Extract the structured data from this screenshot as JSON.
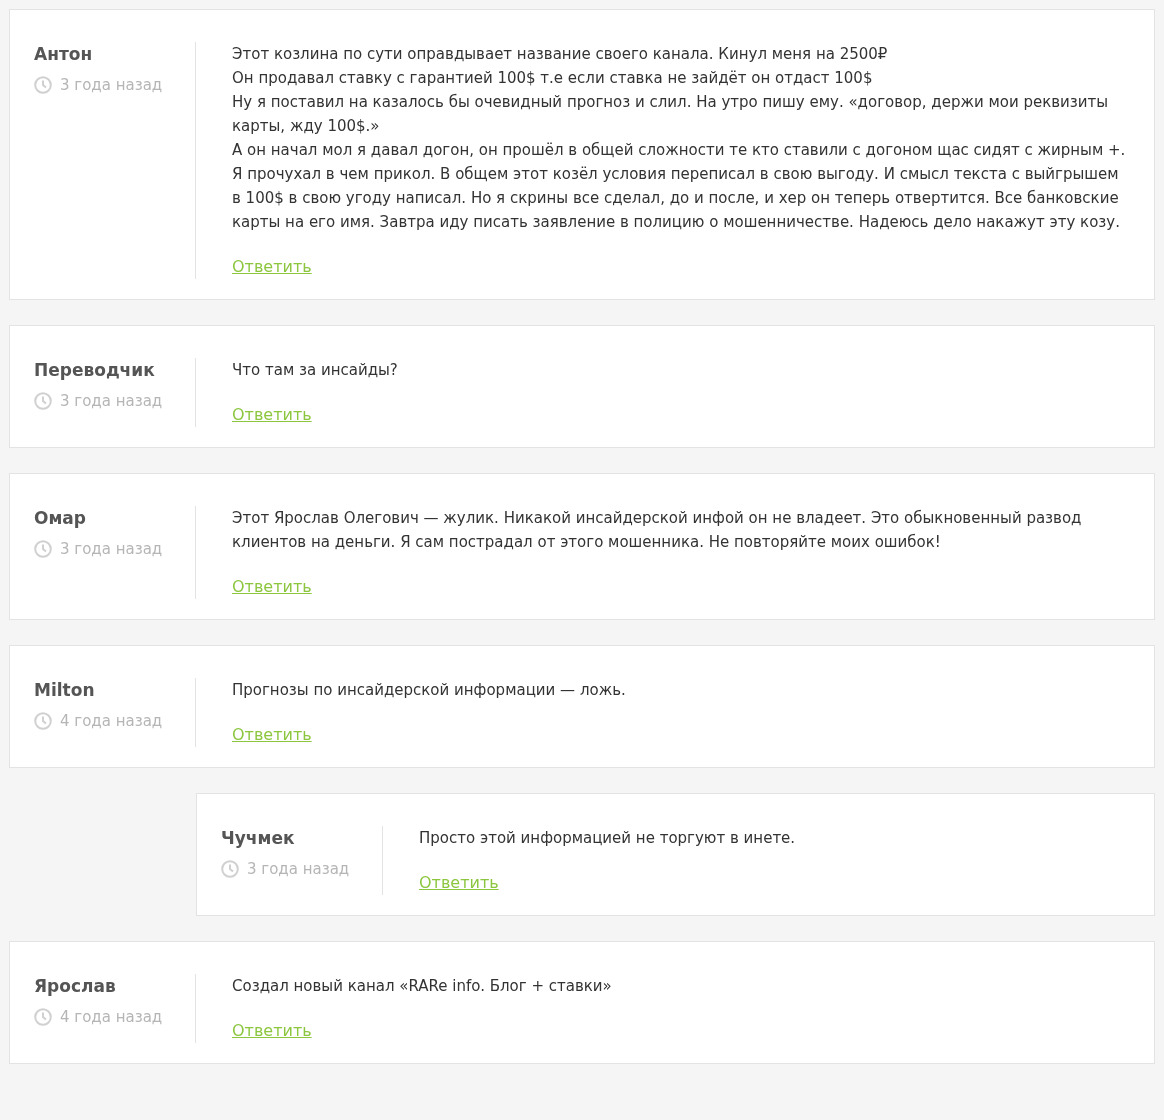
{
  "comments": [
    {
      "author": "Антон",
      "time": "3 года назад",
      "paragraphs": [
        "Этот козлина по сути оправдывает название своего канала. Кинул меня на 2500₽",
        "Он продавал ставку с гарантией 100$ т.е если ставка не зайдёт он отдаст 100$",
        "Ну я поставил на казалось бы очевидный прогноз и слил. На утро пишу ему. «договор, держи мои реквизиты карты, жду 100$.»",
        "А он начал мол я давал догон, он прошёл в общей сложности те кто ставили с догоном щас сидят с жирным +.",
        "Я прочухал в чем прикол. В общем этот козёл условия переписал в свою выгоду. И смысл текста с выйгрышем в 100$ в свою угоду написал. Но я скрины все сделал, до и после, и хер он теперь отвертится. Все банковские карты на его имя. Завтра иду писать заявление в полицию о мошенничестве. Надеюсь дело накажут эту козу."
      ],
      "reply": "Ответить"
    },
    {
      "author": "Переводчик",
      "time": "3 года назад",
      "paragraphs": [
        "Что там за инсайды?"
      ],
      "reply": "Ответить"
    },
    {
      "author": "Омар",
      "time": "3 года назад",
      "paragraphs": [
        "Этот Ярослав Олегович — жулик. Никакой инсайдерской инфой он не владеет. Это обыкновенный развод клиентов на деньги. Я сам пострадал от этого мошенника. Не повторяйте моих ошибок!"
      ],
      "reply": "Ответить"
    },
    {
      "author": "Milton",
      "time": "4 года назад",
      "paragraphs": [
        "Прогнозы по инсайдерской информации — ложь."
      ],
      "reply": "Ответить",
      "children": [
        {
          "author": "Чучмек",
          "time": "3 года назад",
          "paragraphs": [
            "Просто этой информацией не торгуют в инете."
          ],
          "reply": "Ответить"
        }
      ]
    },
    {
      "author": "Ярослав",
      "time": "4 года назад",
      "paragraphs": [
        "Создал новый канал «RARe info. Блог + ставки»"
      ],
      "reply": "Ответить"
    }
  ]
}
